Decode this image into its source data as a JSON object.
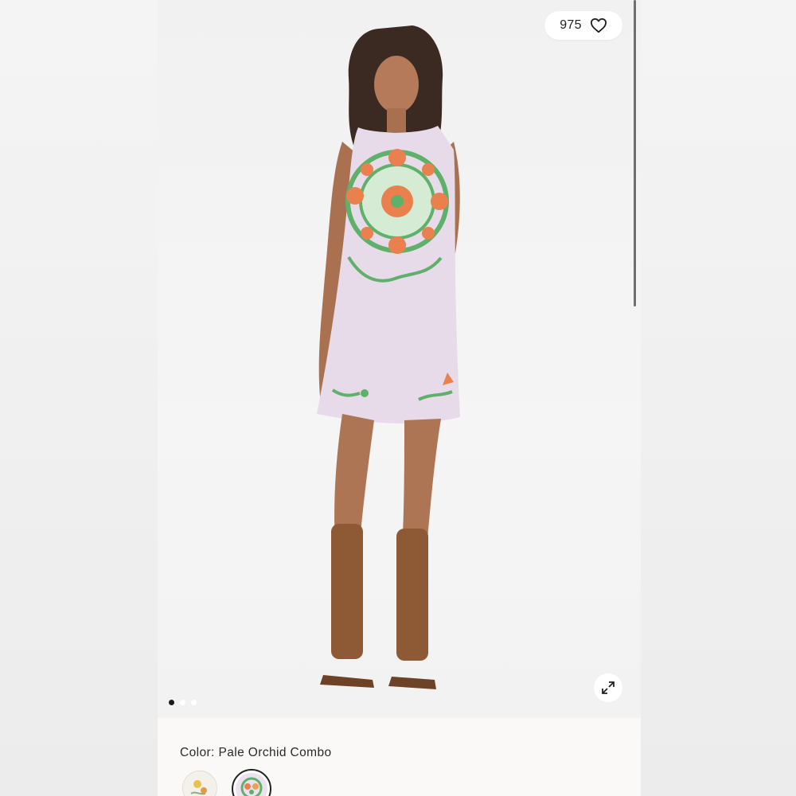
{
  "gallery": {
    "like_count": "975",
    "active_image": 1,
    "total_images": 3
  },
  "product": {
    "color_label": "Color:",
    "color_value": "Pale Orchid Combo",
    "swatches": [
      "floral-print-swatch",
      "pale-orchid-swatch"
    ]
  },
  "colors": {
    "dress": "#e7dbea",
    "embroidery_green": "#5fb06a",
    "embroidery_orange": "#e9804e",
    "sandal_brown": "#8e5a36"
  },
  "icons": {
    "like": "heart-icon",
    "expand": "expand-arrows-icon"
  }
}
